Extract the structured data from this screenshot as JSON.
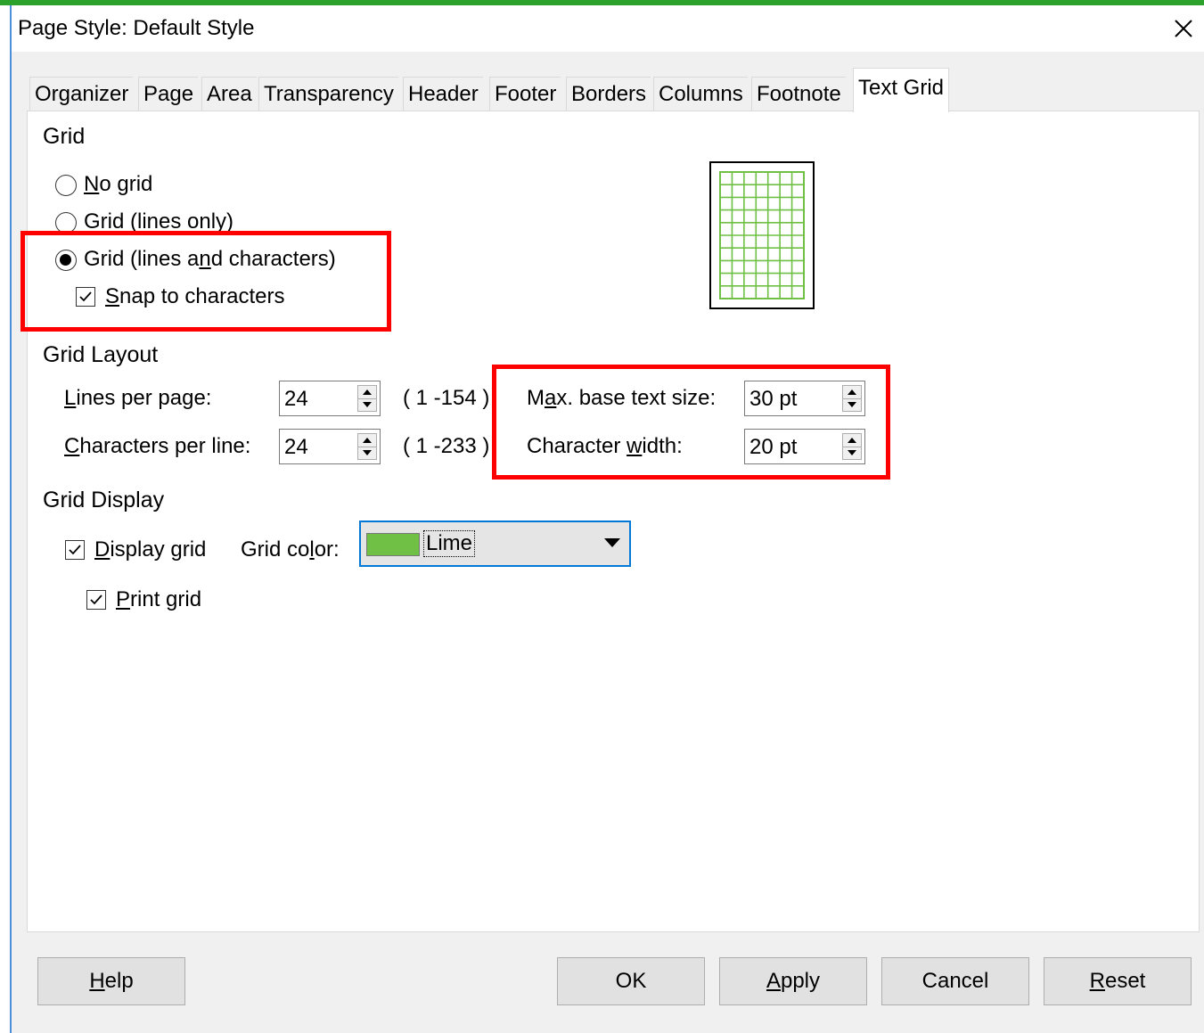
{
  "window": {
    "title": "Page Style: Default Style"
  },
  "tabs": [
    {
      "label": "Organizer"
    },
    {
      "label": "Page"
    },
    {
      "label": "Area"
    },
    {
      "label": "Transparency"
    },
    {
      "label": "Header"
    },
    {
      "label": "Footer"
    },
    {
      "label": "Borders"
    },
    {
      "label": "Columns"
    },
    {
      "label": "Footnote"
    },
    {
      "label": "Text Grid"
    }
  ],
  "grid": {
    "title": "Grid",
    "options": [
      {
        "label": "No grid",
        "checked": false
      },
      {
        "label": "Grid (lines only)",
        "checked": false
      },
      {
        "label": "Grid (lines and characters)",
        "checked": true
      }
    ],
    "snap_label": "Snap to characters",
    "snap_checked": true
  },
  "layout": {
    "title": "Grid Layout",
    "lines_label": "Lines per page:",
    "lines_value": "24",
    "lines_range": "( 1 -154 )",
    "chars_label": "Characters per line:",
    "chars_value": "24",
    "chars_range": "( 1 -233 )",
    "max_label": "Max. base text size:",
    "max_value": "30 pt",
    "width_label": "Character width:",
    "width_value": "20 pt"
  },
  "display": {
    "title": "Grid Display",
    "display_label": "Display grid",
    "display_checked": true,
    "color_label": "Grid color:",
    "color_value": "Lime",
    "color_hex": "#6fc044",
    "print_label": "Print grid",
    "print_checked": true
  },
  "buttons": {
    "help": "Help",
    "ok": "OK",
    "apply": "Apply",
    "cancel": "Cancel",
    "reset": "Reset"
  },
  "colors": {
    "highlight": "#ff0000",
    "focus": "#0078d7",
    "grid_preview": "#6fc044"
  }
}
